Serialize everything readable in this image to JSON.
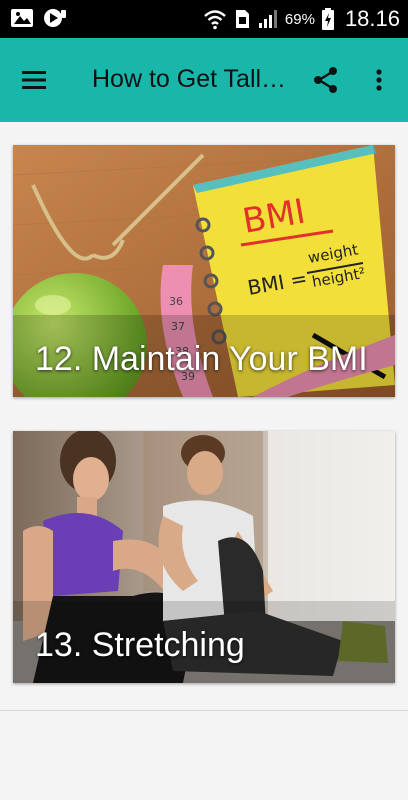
{
  "status_bar": {
    "battery_percent": "69%",
    "time": "18.16"
  },
  "app_bar": {
    "title": "How to Get Tall…",
    "background": "#19b7aa"
  },
  "cards": [
    {
      "title": "12. Maintain Your BMI",
      "illustration": {
        "bmi_heading": "BMI",
        "formula_left": "BMI =",
        "formula_numerator": "weight",
        "formula_denominator": "height²",
        "tape_numbers": [
          "36",
          "37",
          "38",
          "39"
        ]
      }
    },
    {
      "title": "13. Stretching"
    }
  ],
  "icons": {
    "status_left": [
      "image-notification-icon",
      "media-notification-icon"
    ],
    "status_right": [
      "wifi-icon",
      "sim-icon",
      "signal-icon",
      "battery-charging-icon"
    ],
    "app_bar": [
      "hamburger-menu-icon",
      "share-icon",
      "more-vert-icon"
    ]
  }
}
